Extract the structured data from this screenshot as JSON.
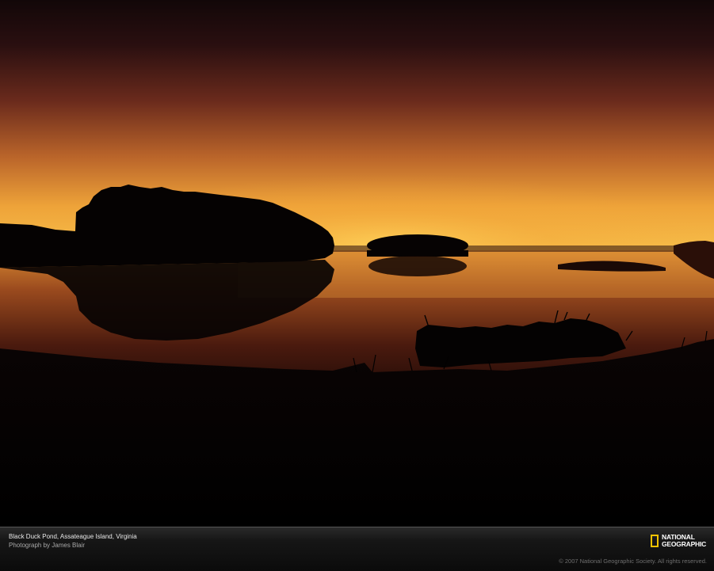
{
  "caption": {
    "title": "Black Duck Pond, Assateague Island, Virginia",
    "credit": "Photograph by James Blair"
  },
  "logo": {
    "text": "NATIONAL\nGEOGRAPHIC",
    "accent_color": "#f2c200"
  },
  "copyright": "© 2007 National Geographic Society. All rights reserved.",
  "colors": {
    "sky_top": "#1a0a0c",
    "horizon_glow": "#f7b640",
    "silhouette": "#050202"
  }
}
